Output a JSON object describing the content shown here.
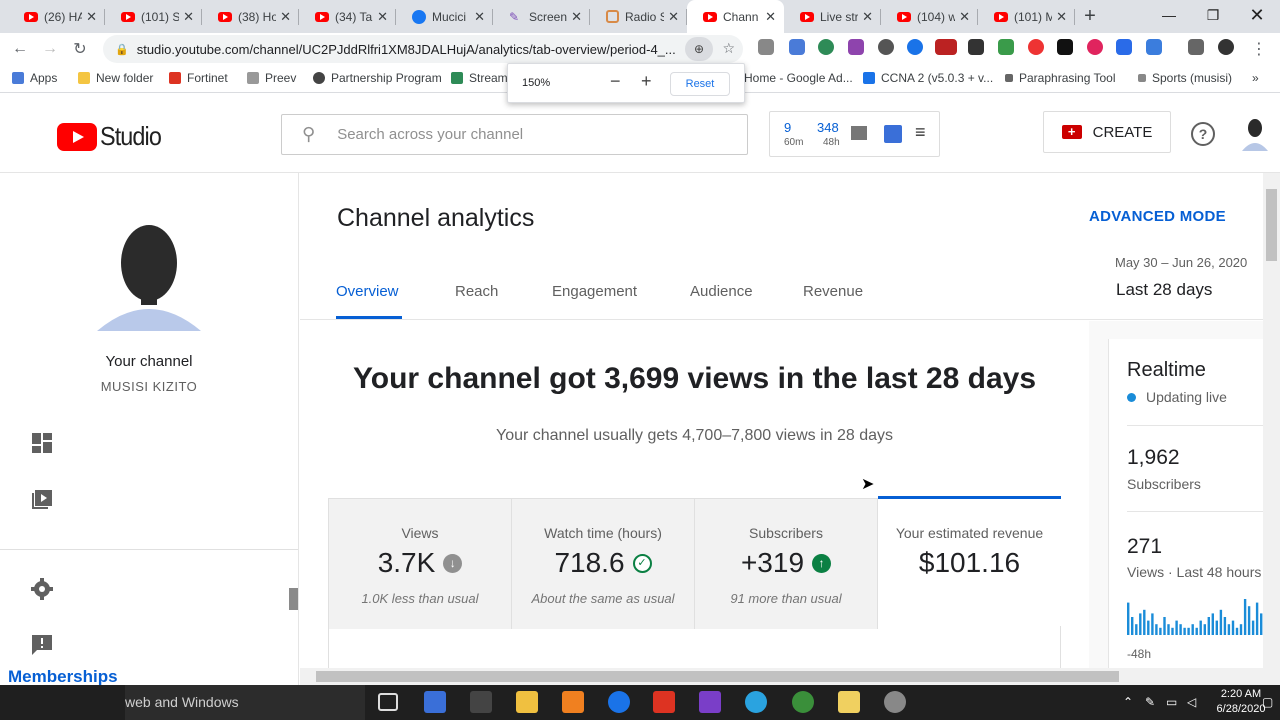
{
  "browser": {
    "tabs": [
      {
        "label": "(26) HA",
        "icon": "youtube-icon"
      },
      {
        "label": "(101) S",
        "icon": "youtube-icon"
      },
      {
        "label": "(38) Ho",
        "icon": "youtube-icon"
      },
      {
        "label": "(34) Ta",
        "icon": "youtube-icon"
      },
      {
        "label": "Mucici",
        "icon": "facebook-icon"
      },
      {
        "label": "Screen",
        "icon": "pen-icon"
      },
      {
        "label": "Radio S",
        "icon": "hexagon-icon"
      },
      {
        "label": "Chann",
        "icon": "youtube-icon",
        "active": true
      },
      {
        "label": "Live str",
        "icon": "youtube-icon"
      },
      {
        "label": "(104) w",
        "icon": "youtube-icon"
      },
      {
        "label": "(101) M",
        "icon": "youtube-icon"
      }
    ],
    "url": "studio.youtube.com/channel/UC2PJddRlfri1XM8JDALHujA/analytics/tab-overview/period-4_...",
    "zoom_popup": {
      "value": "150%",
      "minus": "−",
      "plus": "+",
      "reset": "Reset"
    },
    "bookmarks": [
      "Apps",
      "New folder",
      "Fortinet",
      "Preev",
      "Partnership Program",
      "Stream",
      "Home - Google Ad...",
      "CCNA 2 (v5.0.3 + v...",
      "Paraphrasing Tool",
      "Sports (musisi)",
      "»"
    ]
  },
  "studio": {
    "logo_text": "Studio",
    "search_placeholder": "Search across your channel",
    "realtime_widget": {
      "n1": "9",
      "n1_sub": "60m",
      "n2": "348",
      "n2_sub": "48h"
    },
    "create_label": "CREATE",
    "help_label": "?"
  },
  "sidebar": {
    "channel_label": "Your channel",
    "channel_name": "MUSISI KIZITO",
    "memberships": "Memberships"
  },
  "main": {
    "title": "Channel analytics",
    "advanced_mode": "ADVANCED MODE",
    "date_range": "May 30 – Jun 26, 2020",
    "date_period": "Last 28 days",
    "tabs": [
      "Overview",
      "Reach",
      "Engagement",
      "Audience",
      "Revenue"
    ],
    "headline": "Your channel got 3,699 views in the last 28 days",
    "subline": "Your channel usually gets 4,700–7,800 views in 28 days",
    "cards": [
      {
        "title": "Views",
        "value": "3.7K",
        "note": "1.0K less than usual",
        "badge": "↓"
      },
      {
        "title": "Watch time (hours)",
        "value": "718.6",
        "note": "About the same as usual",
        "badge": "✓"
      },
      {
        "title": "Subscribers",
        "value": "+319",
        "note": "91 more than usual",
        "badge": "↑"
      },
      {
        "title": "Your estimated revenue",
        "value": "$101.16",
        "note": ""
      }
    ]
  },
  "realtime": {
    "title": "Realtime",
    "status": "Updating live",
    "subscribers_value": "1,962",
    "subscribers_label": "Subscribers",
    "views_value": "271",
    "views_label": "Views · Last 48 hours",
    "axis_label": "-48h",
    "bars": [
      0.9,
      0.5,
      0.3,
      0.6,
      0.7,
      0.4,
      0.6,
      0.3,
      0.2,
      0.5,
      0.3,
      0.2,
      0.4,
      0.3,
      0.2,
      0.2,
      0.3,
      0.2,
      0.4,
      0.3,
      0.5,
      0.6,
      0.4,
      0.7,
      0.5,
      0.3,
      0.4,
      0.2,
      0.3,
      1.0,
      0.8,
      0.4,
      0.9,
      0.6
    ],
    "bar_color": "#1a8cd8"
  },
  "taskbar": {
    "search_text": "web and Windows",
    "time": "2:20 AM",
    "date": "6/28/2020"
  }
}
